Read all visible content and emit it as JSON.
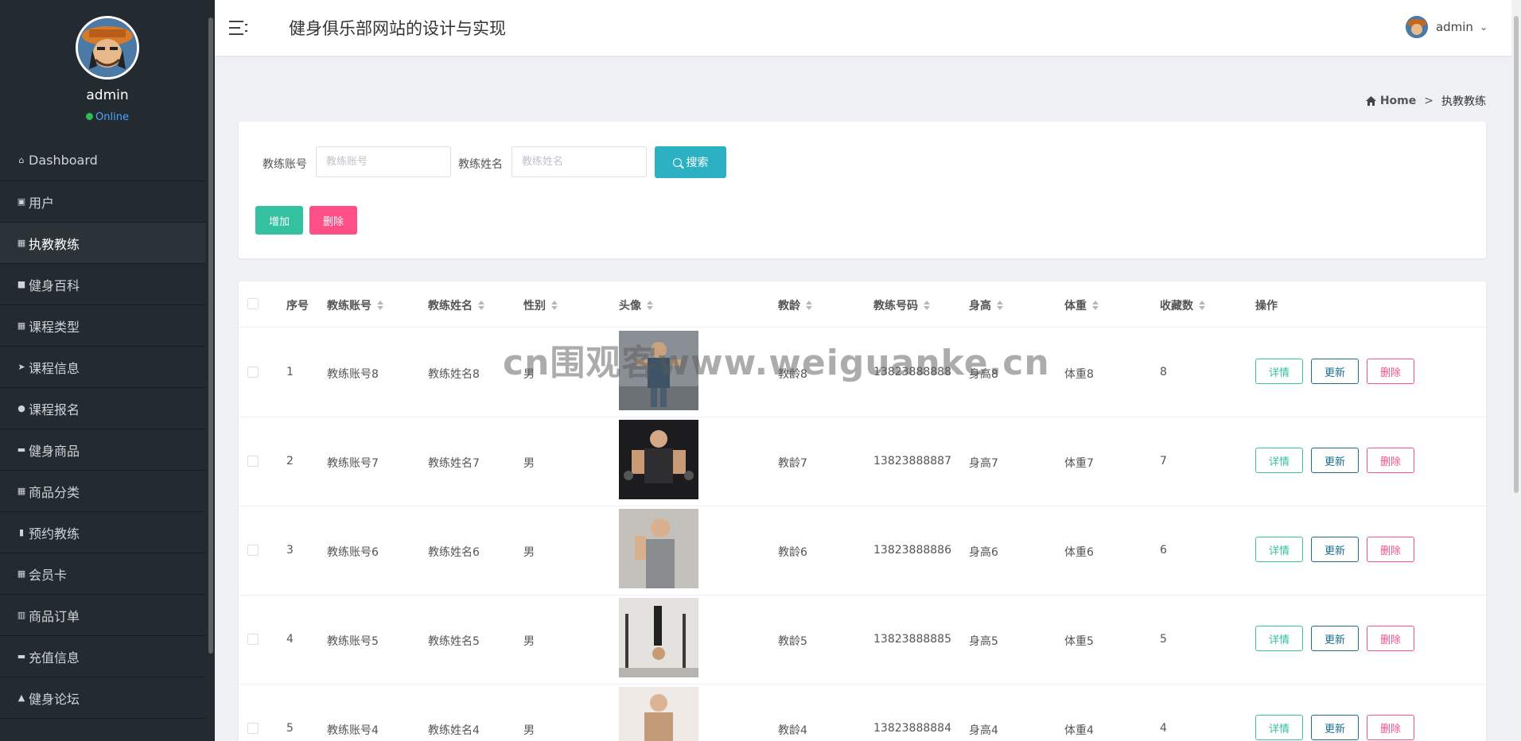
{
  "sidebar": {
    "username": "admin",
    "status": "Online",
    "items": [
      {
        "label": "Dashboard",
        "icon": "home-icon",
        "glyph": "⌂"
      },
      {
        "label": "用户",
        "icon": "user-icon",
        "glyph": "▣"
      },
      {
        "label": "执教教练",
        "icon": "grid-icon",
        "glyph": "▦"
      },
      {
        "label": "健身百科",
        "icon": "briefcase-icon",
        "glyph": "■"
      },
      {
        "label": "课程类型",
        "icon": "grid-icon",
        "glyph": "▦"
      },
      {
        "label": "课程信息",
        "icon": "send-icon",
        "glyph": "➤"
      },
      {
        "label": "课程报名",
        "icon": "location-icon",
        "glyph": "●"
      },
      {
        "label": "健身商品",
        "icon": "ticket-icon",
        "glyph": "▬"
      },
      {
        "label": "商品分类",
        "icon": "grid-icon",
        "glyph": "▦"
      },
      {
        "label": "预约教练",
        "icon": "book-icon",
        "glyph": "▮"
      },
      {
        "label": "会员卡",
        "icon": "apps-icon",
        "glyph": "▦"
      },
      {
        "label": "商品订单",
        "icon": "chart-icon",
        "glyph": "▥"
      },
      {
        "label": "充值信息",
        "icon": "comment-icon",
        "glyph": "▬"
      },
      {
        "label": "健身论坛",
        "icon": "person-icon",
        "glyph": "▲"
      }
    ],
    "active_index": 2
  },
  "header": {
    "title": "健身俱乐部网站的设计与实现",
    "user": "admin"
  },
  "breadcrumb": {
    "home": "Home",
    "separator": ">",
    "current": "执教教练"
  },
  "search": {
    "account_label": "教练账号",
    "account_placeholder": "教练账号",
    "name_label": "教练姓名",
    "name_placeholder": "教练姓名",
    "search_button": "搜索",
    "add_button": "增加",
    "delete_button": "删除"
  },
  "table": {
    "headers": [
      "序号",
      "教练账号",
      "教练姓名",
      "性别",
      "头像",
      "教龄",
      "教练号码",
      "身高",
      "体重",
      "收藏数",
      "操作"
    ],
    "rows": [
      {
        "no": "1",
        "account": "教练账号8",
        "name": "教练姓名8",
        "gender": "男",
        "years": "教龄8",
        "phone": "13823888888",
        "height": "身高8",
        "weight": "体重8",
        "favorites": "8"
      },
      {
        "no": "2",
        "account": "教练账号7",
        "name": "教练姓名7",
        "gender": "男",
        "years": "教龄7",
        "phone": "13823888887",
        "height": "身高7",
        "weight": "体重7",
        "favorites": "7"
      },
      {
        "no": "3",
        "account": "教练账号6",
        "name": "教练姓名6",
        "gender": "男",
        "years": "教龄6",
        "phone": "13823888886",
        "height": "身高6",
        "weight": "体重6",
        "favorites": "6"
      },
      {
        "no": "4",
        "account": "教练账号5",
        "name": "教练姓名5",
        "gender": "男",
        "years": "教龄5",
        "phone": "13823888885",
        "height": "身高5",
        "weight": "体重5",
        "favorites": "5"
      },
      {
        "no": "5",
        "account": "教练账号4",
        "name": "教练姓名4",
        "gender": "男",
        "years": "教龄4",
        "phone": "13823888884",
        "height": "身高4",
        "weight": "体重4",
        "favorites": "4"
      }
    ],
    "actions": {
      "detail": "详情",
      "update": "更新",
      "delete": "删除"
    }
  },
  "watermark": "cn围观客www.weiguanke.cn",
  "colors": {
    "sidebar_bg": "#232b31",
    "search_btn": "#2bb1c1",
    "add_btn": "#33c1a1",
    "delete_btn": "#ff4f87",
    "update_btn": "#1f6b8e",
    "online": "#2ebd4e"
  }
}
